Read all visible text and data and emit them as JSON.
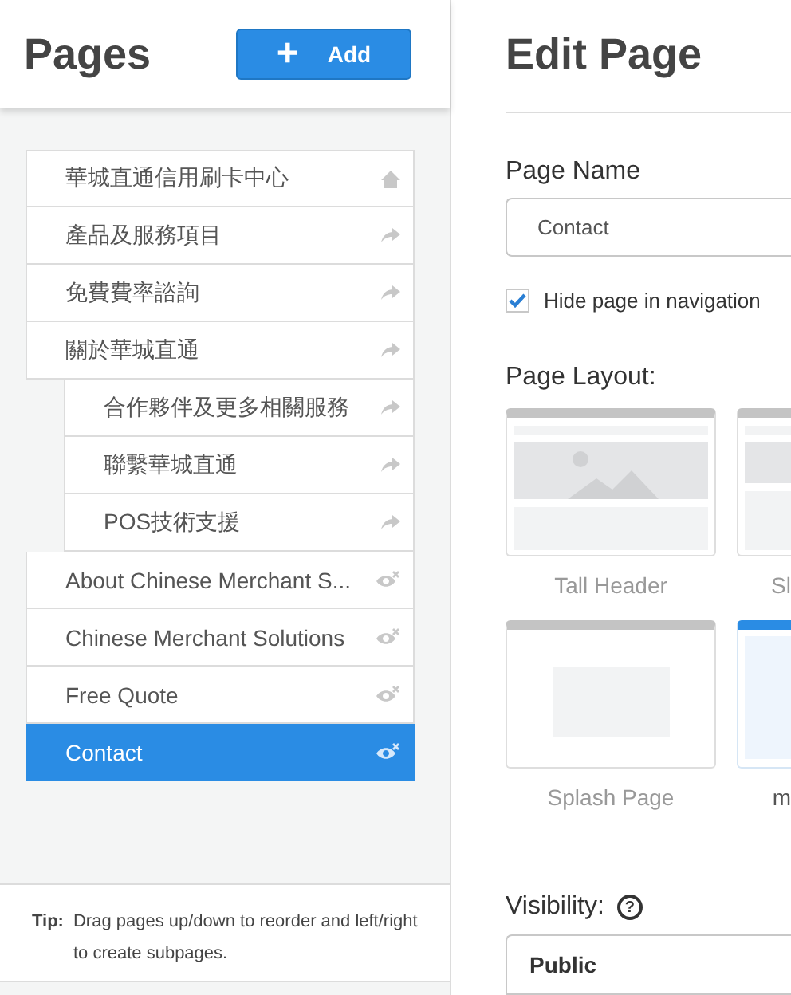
{
  "sidebar": {
    "title": "Pages",
    "add_button": {
      "icon": "+",
      "label": "Add"
    },
    "pages": [
      {
        "label": "華城直通信用刷卡中心",
        "kind": "home",
        "selected": false
      },
      {
        "label": "產品及服務項目",
        "kind": "link",
        "selected": false
      },
      {
        "label": "免費費率諮詢",
        "kind": "link",
        "selected": false
      },
      {
        "label": "關於華城直通",
        "kind": "link",
        "selected": false,
        "children": [
          {
            "label": "合作夥伴及更多相關服務",
            "kind": "link",
            "selected": false
          },
          {
            "label": "聯繫華城直通",
            "kind": "link",
            "selected": false
          },
          {
            "label": "POS技術支援",
            "kind": "link",
            "selected": false
          }
        ]
      },
      {
        "label": "About Chinese Merchant S...",
        "kind": "hidden",
        "selected": false
      },
      {
        "label": "Chinese Merchant Solutions",
        "kind": "hidden",
        "selected": false
      },
      {
        "label": "Free Quote",
        "kind": "hidden",
        "selected": false
      },
      {
        "label": "Contact",
        "kind": "hidden",
        "selected": true
      }
    ],
    "tip": {
      "label": "Tip:",
      "text": "Drag pages up/down to reorder and left/right to create subpages."
    }
  },
  "editor": {
    "title": "Edit Page",
    "page_name_label": "Page Name",
    "page_name_value": "Contact",
    "hide_in_navigation": {
      "label": "Hide page in navigation",
      "checked": true
    },
    "layout_label": "Page Layout:",
    "layouts": [
      {
        "label": "Tall Header",
        "kind": "tall-header",
        "selected": false
      },
      {
        "label": "Sl",
        "kind": "side",
        "selected": false
      },
      {
        "label": "Splash Page",
        "kind": "splash",
        "selected": false
      },
      {
        "label": "m",
        "kind": "blank",
        "selected": true
      }
    ],
    "visibility_label": "Visibility:",
    "help_icon": "?",
    "visibility_value": "Public"
  }
}
